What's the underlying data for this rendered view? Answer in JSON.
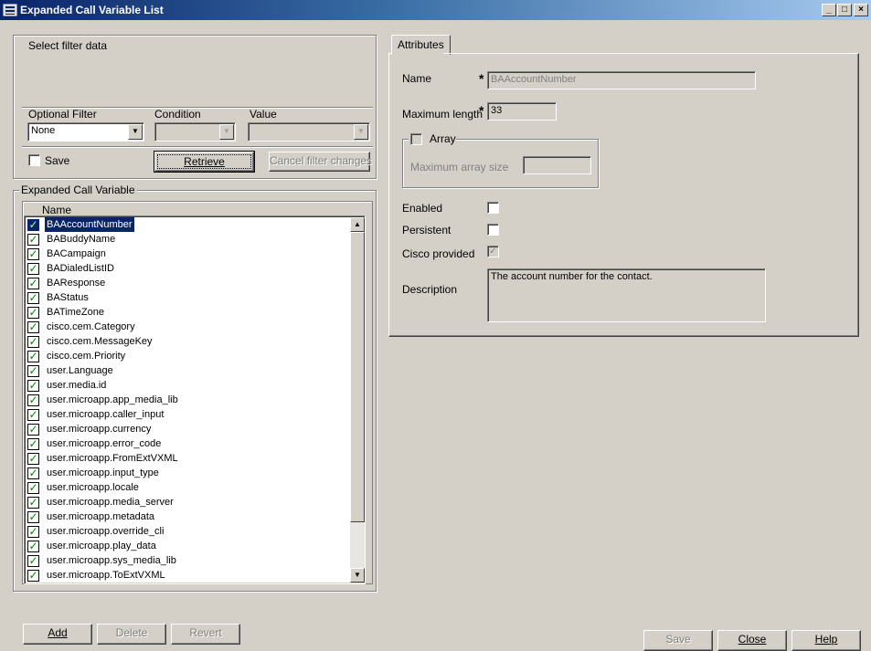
{
  "window": {
    "title": "Expanded Call Variable List",
    "controls": {
      "minimize": "_",
      "maximize": "□",
      "close": "×"
    }
  },
  "filter": {
    "group_label": "Select filter data",
    "optional_filter_label": "Optional Filter",
    "condition_label": "Condition",
    "value_label": "Value",
    "optional_filter_value": "None",
    "condition_value": "",
    "value_value": "",
    "save_label": "Save",
    "retrieve_label": "Retrieve",
    "cancel_label": "Cancel filter changes"
  },
  "list": {
    "group_label": "Expanded Call Variable",
    "column_header": "Name",
    "items": [
      "BAAccountNumber",
      "BABuddyName",
      "BACampaign",
      "BADialedListID",
      "BAResponse",
      "BAStatus",
      "BATimeZone",
      "cisco.cem.Category",
      "cisco.cem.MessageKey",
      "cisco.cem.Priority",
      "user.Language",
      "user.media.id",
      "user.microapp.app_media_lib",
      "user.microapp.caller_input",
      "user.microapp.currency",
      "user.microapp.error_code",
      "user.microapp.FromExtVXML",
      "user.microapp.input_type",
      "user.microapp.locale",
      "user.microapp.media_server",
      "user.microapp.metadata",
      "user.microapp.override_cli",
      "user.microapp.play_data",
      "user.microapp.sys_media_lib",
      "user.microapp.ToExtVXML"
    ],
    "selected_index": 0
  },
  "bottom_buttons": {
    "add": "Add",
    "delete": "Delete",
    "revert": "Revert",
    "save": "Save",
    "close": "Close",
    "help": "Help"
  },
  "attributes": {
    "tab_label": "Attributes",
    "name_label": "Name",
    "name_value": "BAAccountNumber",
    "required_marker": "*",
    "max_length_label": "Maximum length",
    "max_length_value": "33",
    "array_label": "Array",
    "max_array_size_label": "Maximum array size",
    "max_array_size_value": "",
    "enabled_label": "Enabled",
    "persistent_label": "Persistent",
    "cisco_provided_label": "Cisco provided",
    "cisco_provided_mark": "✓",
    "description_label": "Description",
    "description_value": "The account number for the contact."
  },
  "colors": {
    "window_bg": "#d4d0c8",
    "selection": "#0a246a",
    "check_green": "#008000"
  }
}
